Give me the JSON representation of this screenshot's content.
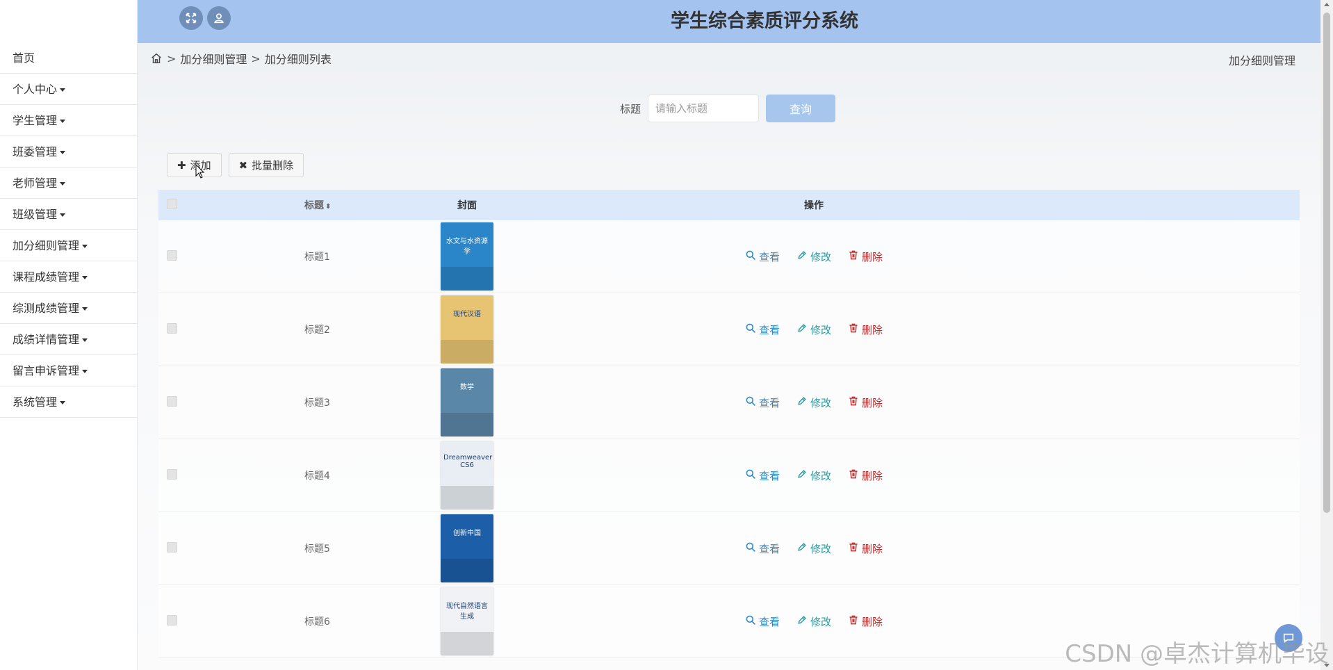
{
  "header": {
    "title": "学生综合素质评分系统"
  },
  "sidebar": {
    "items": [
      {
        "label": "首页",
        "has_caret": false
      },
      {
        "label": "个人中心",
        "has_caret": true
      },
      {
        "label": "学生管理",
        "has_caret": true
      },
      {
        "label": "班委管理",
        "has_caret": true
      },
      {
        "label": "老师管理",
        "has_caret": true
      },
      {
        "label": "班级管理",
        "has_caret": true
      },
      {
        "label": "加分细则管理",
        "has_caret": true
      },
      {
        "label": "课程成绩管理",
        "has_caret": true
      },
      {
        "label": "综测成绩管理",
        "has_caret": true
      },
      {
        "label": "成绩详情管理",
        "has_caret": true
      },
      {
        "label": "留言申诉管理",
        "has_caret": true
      },
      {
        "label": "系统管理",
        "has_caret": true
      }
    ]
  },
  "breadcrumb": {
    "items": [
      "加分细则管理",
      "加分细则列表"
    ],
    "right": "加分细则管理"
  },
  "search": {
    "label": "标题",
    "placeholder": "请输入标题",
    "button": "查询"
  },
  "actions": {
    "add": "添加",
    "batch_delete": "批量删除"
  },
  "table": {
    "headers": {
      "title": "标题",
      "cover": "封面",
      "ops": "操作"
    },
    "rows": [
      {
        "title": "标题1",
        "cover_text": "水文与水资源学",
        "cover_color": "#2a86c8"
      },
      {
        "title": "标题2",
        "cover_text": "现代汉语",
        "cover_color": "#e6c472"
      },
      {
        "title": "标题3",
        "cover_text": "数学",
        "cover_color": "#5a86a8"
      },
      {
        "title": "标题4",
        "cover_text": "Dreamweaver CS6",
        "cover_color": "#e8eef3"
      },
      {
        "title": "标题5",
        "cover_text": "创新中国",
        "cover_color": "#1d5ea8"
      },
      {
        "title": "标题6",
        "cover_text": "现代自然语言生成",
        "cover_color": "#f0f2f5"
      }
    ],
    "ops": {
      "view": "查看",
      "edit": "修改",
      "delete": "删除"
    }
  },
  "watermark": "CSDN @卓杰计算机毕设"
}
